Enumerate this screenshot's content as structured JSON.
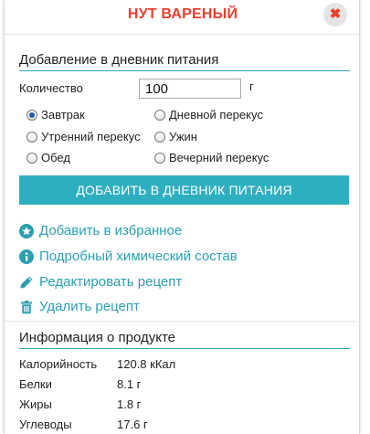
{
  "dialog": {
    "title": "НУТ ВАРЕНЫЙ",
    "close_glyph": "✖",
    "accent_color": "#2eafbf",
    "title_color": "#e8402f"
  },
  "diary": {
    "section_title": "Добавление в дневник питания",
    "quantity_label": "Количество",
    "quantity_value": "100",
    "unit": "г",
    "meals": [
      {
        "label": "Завтрак",
        "checked": true
      },
      {
        "label": "Дневной перекус",
        "checked": false
      },
      {
        "label": "Утренний перекус",
        "checked": false
      },
      {
        "label": "Ужин",
        "checked": false
      },
      {
        "label": "Обед",
        "checked": false
      },
      {
        "label": "Вечерний перекус",
        "checked": false
      }
    ],
    "add_button": "ДОБАВИТЬ В ДНЕВНИК ПИТАНИЯ"
  },
  "actions": [
    {
      "label": "Добавить в избранное",
      "icon": "star-icon"
    },
    {
      "label": "Подробный химический состав",
      "icon": "info-icon"
    },
    {
      "label": "Редактировать рецепт",
      "icon": "pencil-icon"
    },
    {
      "label": "Удалить рецепт",
      "icon": "trash-icon"
    }
  ],
  "product_info": {
    "section_title": "Информация о продукте",
    "rows": [
      {
        "name": "Калорийность",
        "value": "120.8 кКал"
      },
      {
        "name": "Белки",
        "value": "8.1 г"
      },
      {
        "name": "Жиры",
        "value": "1.8 г"
      },
      {
        "name": "Углеводы",
        "value": "17.6 г"
      }
    ]
  }
}
